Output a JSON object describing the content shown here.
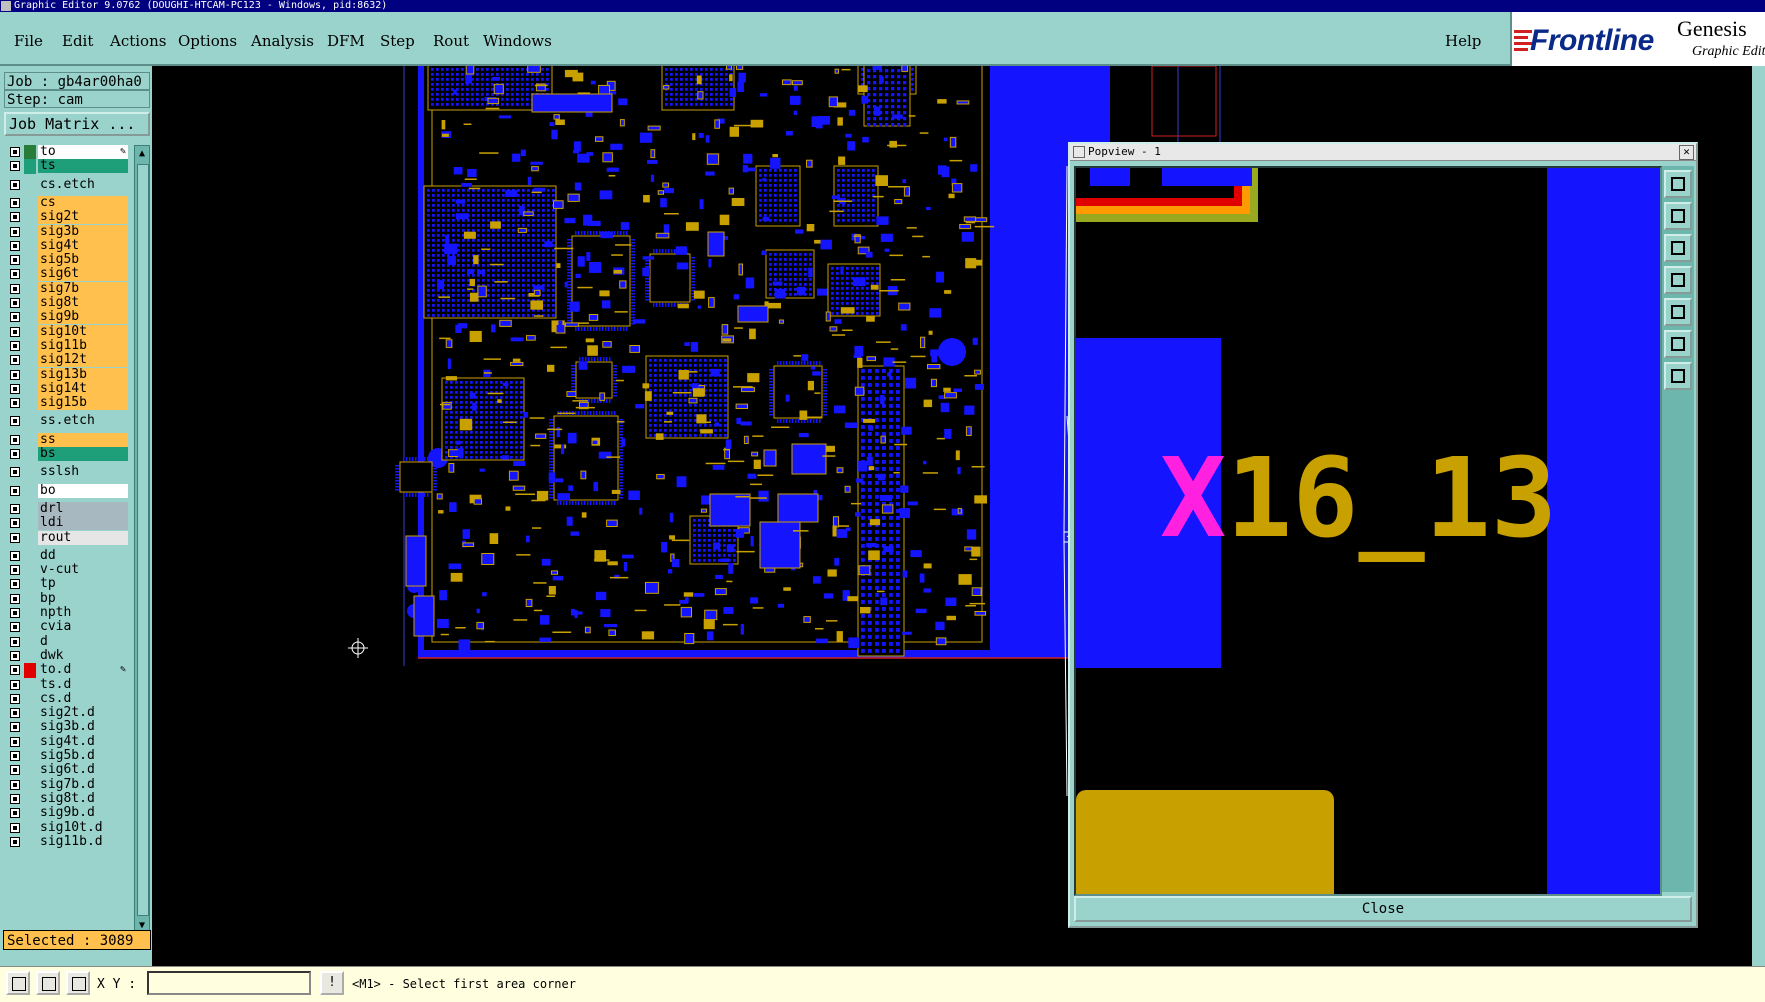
{
  "window": {
    "title": "Graphic Editor 9.0762  (DOUGHI-HTCAM-PC123 - Windows, pid:8632)"
  },
  "menu": {
    "items": [
      {
        "label": "File"
      },
      {
        "label": "Edit"
      },
      {
        "label": "Actions"
      },
      {
        "label": "Options"
      },
      {
        "label": "Analysis"
      },
      {
        "label": "DFM"
      },
      {
        "label": "Step"
      },
      {
        "label": "Rout"
      },
      {
        "label": "Windows"
      }
    ],
    "help": "Help"
  },
  "logo": {
    "brand": "Frontline",
    "product": "Genesis",
    "subtitle": "Graphic Editor"
  },
  "panel": {
    "job": "Job : gb4ar00ha0",
    "step": "Step: cam",
    "job_matrix": "Job Matrix ...",
    "selected": "Selected : 3089"
  },
  "layers": [
    {
      "name": "to",
      "color": "#ffffff",
      "sw": "#2a7c3a",
      "edit": true,
      "arrow": true
    },
    {
      "name": "ts",
      "color": "#1f9e7a",
      "sw": "#1f9e7a"
    },
    {
      "name": "cs.etch",
      "color": "#9ad2cc",
      "sw": ""
    },
    {
      "name": "cs",
      "color": "#ffc04d",
      "sw": ""
    },
    {
      "name": "sig2t",
      "color": "#ffc04d",
      "sw": ""
    },
    {
      "name": "sig3b",
      "color": "#ffc04d",
      "sw": ""
    },
    {
      "name": "sig4t",
      "color": "#ffc04d",
      "sw": ""
    },
    {
      "name": "sig5b",
      "color": "#ffc04d",
      "sw": ""
    },
    {
      "name": "sig6t",
      "color": "#ffc04d",
      "sw": ""
    },
    {
      "name": "sig7b",
      "color": "#ffc04d",
      "sw": ""
    },
    {
      "name": "sig8t",
      "color": "#ffc04d",
      "sw": ""
    },
    {
      "name": "sig9b",
      "color": "#ffc04d",
      "sw": ""
    },
    {
      "name": "sig10t",
      "color": "#ffc04d",
      "sw": ""
    },
    {
      "name": "sig11b",
      "color": "#ffc04d",
      "sw": ""
    },
    {
      "name": "sig12t",
      "color": "#ffc04d",
      "sw": ""
    },
    {
      "name": "sig13b",
      "color": "#ffc04d",
      "sw": ""
    },
    {
      "name": "sig14t",
      "color": "#ffc04d",
      "sw": ""
    },
    {
      "name": "sig15b",
      "color": "#ffc04d",
      "sw": ""
    },
    {
      "name": "ss.etch",
      "color": "#9ad2cc",
      "sw": ""
    },
    {
      "name": "ss",
      "color": "#ffc04d",
      "sw": ""
    },
    {
      "name": "bs",
      "color": "#1f9e7a",
      "sw": ""
    },
    {
      "name": "sslsh",
      "color": "#9ad2cc",
      "sw": ""
    },
    {
      "name": "bo",
      "color": "#ffffff",
      "sw": ""
    },
    {
      "name": "drl",
      "color": "#a8b8c0",
      "sw": ""
    },
    {
      "name": "ldi",
      "color": "#a8b8c0",
      "sw": ""
    },
    {
      "name": "rout",
      "color": "#e6e6e6",
      "sw": ""
    },
    {
      "name": "dd",
      "color": "#9ad2cc",
      "sw": ""
    },
    {
      "name": "v-cut",
      "color": "#9ad2cc",
      "sw": ""
    },
    {
      "name": "tp",
      "color": "#9ad2cc",
      "sw": ""
    },
    {
      "name": "bp",
      "color": "#9ad2cc",
      "sw": ""
    },
    {
      "name": "npth",
      "color": "#9ad2cc",
      "sw": ""
    },
    {
      "name": "cvia",
      "color": "#9ad2cc",
      "sw": ""
    },
    {
      "name": "d",
      "color": "#9ad2cc",
      "sw": ""
    },
    {
      "name": "dwk",
      "color": "#9ad2cc",
      "sw": ""
    },
    {
      "name": "to.d",
      "color": "#9ad2cc",
      "sw": "#e00000",
      "edit": true
    },
    {
      "name": "ts.d",
      "color": "#9ad2cc",
      "sw": ""
    },
    {
      "name": "cs.d",
      "color": "#9ad2cc",
      "sw": ""
    },
    {
      "name": "sig2t.d",
      "color": "#9ad2cc",
      "sw": ""
    },
    {
      "name": "sig3b.d",
      "color": "#9ad2cc",
      "sw": ""
    },
    {
      "name": "sig4t.d",
      "color": "#9ad2cc",
      "sw": ""
    },
    {
      "name": "sig5b.d",
      "color": "#9ad2cc",
      "sw": ""
    },
    {
      "name": "sig6t.d",
      "color": "#9ad2cc",
      "sw": ""
    },
    {
      "name": "sig7b.d",
      "color": "#9ad2cc",
      "sw": ""
    },
    {
      "name": "sig8t.d",
      "color": "#9ad2cc",
      "sw": ""
    },
    {
      "name": "sig9b.d",
      "color": "#9ad2cc",
      "sw": ""
    },
    {
      "name": "sig10t.d",
      "color": "#9ad2cc",
      "sw": ""
    },
    {
      "name": "sig11b.d",
      "color": "#9ad2cc",
      "sw": ""
    }
  ],
  "popview": {
    "title": "Popview - 1",
    "zoom_label": "X16_13",
    "close": "Close"
  },
  "status": {
    "xy_label": "X Y :",
    "xy_value": "",
    "prompt": "<M1> - Select first area corner"
  },
  "colors": {
    "panel": "#9ad2cc",
    "board_blue": "#1414ff",
    "trace_gold": "#c8a000",
    "highlight_magenta": "#ff20e0"
  }
}
